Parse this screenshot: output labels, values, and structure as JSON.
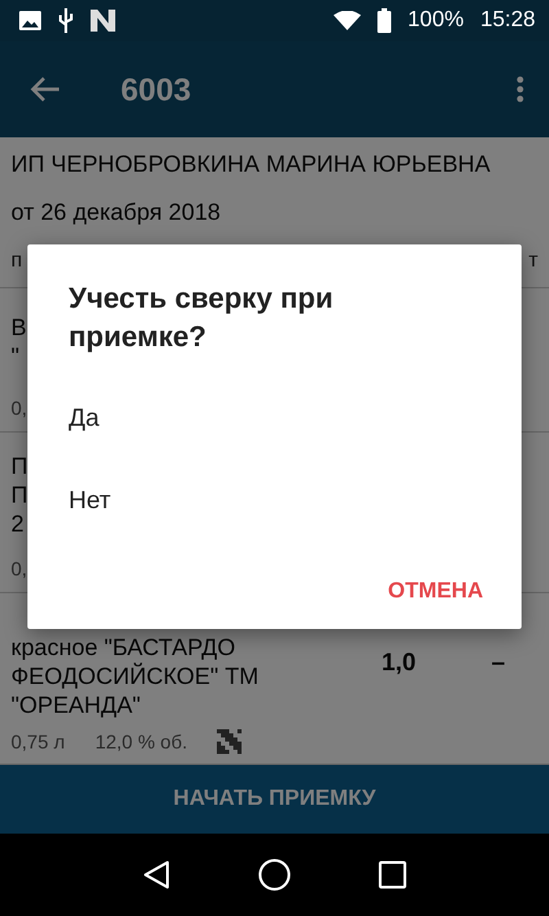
{
  "status_bar": {
    "battery": "100%",
    "time": "15:28"
  },
  "app_bar": {
    "title": "6003"
  },
  "header": {
    "supplier": "ИП ЧЕРНОБРОВКИНА МАРИНА ЮРЬЕВНА",
    "date": "от 26 декабря 2018"
  },
  "column_headers": {
    "column_1": "п",
    "column_2": "т"
  },
  "items": [
    {
      "name_lines": [
        "В",
        "\""
      ],
      "meta": [
        {
          "kind": "text",
          "text": "0,"
        }
      ]
    },
    {
      "name_lines": [
        "П",
        "П",
        "2"
      ],
      "meta": [
        {
          "kind": "text",
          "text": "0,"
        }
      ]
    },
    {
      "name_lines": [
        "красное \"БАСТАРДО",
        "ФЕОДОСИЙСКОЕ\" ТМ",
        "\"ОРЕАНДА\""
      ],
      "quantity": "1,0",
      "column_3": "–",
      "meta": [
        {
          "kind": "text",
          "text": "0,75 л"
        },
        {
          "kind": "text",
          "text": "12,0 % об."
        },
        {
          "kind": "code"
        }
      ]
    }
  ],
  "bottom_button": "НАЧАТЬ ПРИЕМКУ",
  "dialog": {
    "title": "Учесть сверку при приемке?",
    "options": [
      "Да",
      "Нет"
    ],
    "cancel": "ОТМЕНА"
  }
}
